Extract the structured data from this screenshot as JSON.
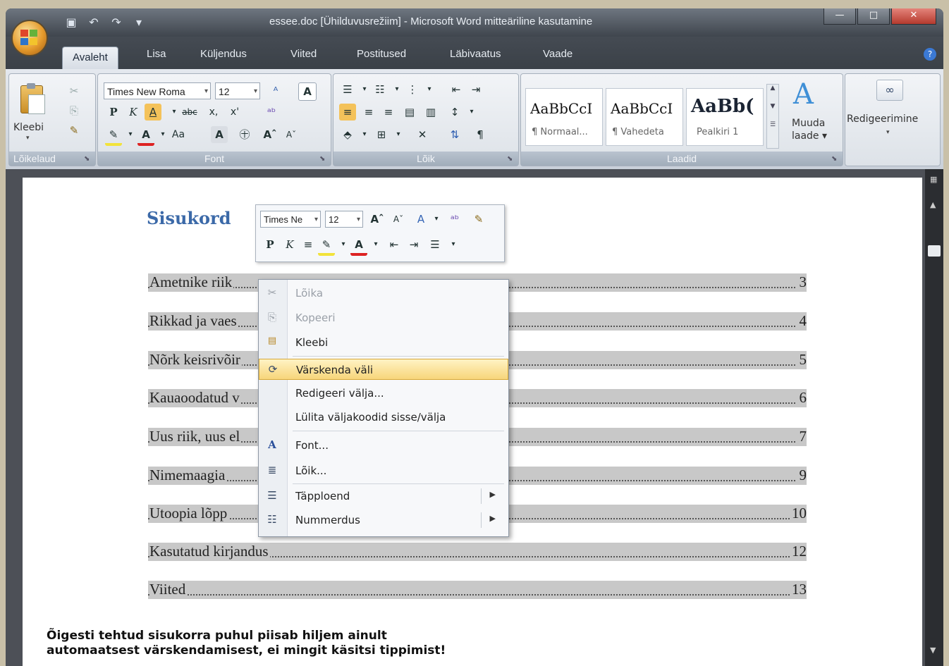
{
  "window": {
    "title": "essee.doc [Ühilduvusrežiim] - Microsoft Word mitteäriline kasutamine"
  },
  "tabs": [
    "Avaleht",
    "Lisa",
    "Küljendus",
    "Viited",
    "Postitused",
    "Läbivaatus",
    "Vaade"
  ],
  "ribbon": {
    "clipboard": {
      "paste_label": "Kleebi",
      "group": "Lõikelaud"
    },
    "font": {
      "family": "Times New Roma",
      "size": "12",
      "group": "Font",
      "case_label": "Aa"
    },
    "paragraph": {
      "group": "Lõik"
    },
    "styles": {
      "group": "Laadid",
      "items": [
        {
          "sample": "AaBbCcI",
          "name": "¶ Normaal..."
        },
        {
          "sample": "AaBbCcI",
          "name": "¶ Vahedeta"
        },
        {
          "sample": "AaBb(",
          "name": "Pealkiri 1"
        }
      ],
      "change_label_1": "Muuda",
      "change_label_2": "laade"
    },
    "editing": {
      "label": "Redigeerimine"
    }
  },
  "mini_toolbar": {
    "font": "Times Ne",
    "size": "12"
  },
  "document": {
    "heading": "Sisukord",
    "toc": [
      {
        "title": "Ametnike riik",
        "page": "3"
      },
      {
        "title": "Rikkad ja vaes",
        "page": "4"
      },
      {
        "title": "Nõrk keisrivõir",
        "page": "5"
      },
      {
        "title": "Kauaoodatud v",
        "page": "6"
      },
      {
        "title": "Uus riik, uus el",
        "page": "7"
      },
      {
        "title": "Nimemaagia",
        "page": "9"
      },
      {
        "title": "Utoopia lõpp",
        "page": "10"
      },
      {
        "title": "Kasutatud kirjandus",
        "page": "12"
      },
      {
        "title": "Viited",
        "page": "13"
      }
    ]
  },
  "context_menu": {
    "items": [
      {
        "label": "Lõika",
        "icon": "scissors-icon",
        "glyph": "✂"
      },
      {
        "label": "Kopeeri",
        "icon": "copy-icon",
        "glyph": "⎘"
      },
      {
        "label": "Kleebi",
        "icon": "paste-icon",
        "glyph": "📋"
      },
      {
        "label": "Värskenda väli",
        "icon": "update-field-icon",
        "glyph": "⟳"
      },
      {
        "label": "Redigeeri välja...",
        "icon": "",
        "glyph": ""
      },
      {
        "label": "Lülita väljakoodid sisse/välja",
        "icon": "",
        "glyph": ""
      },
      {
        "label": "Font...",
        "icon": "font-icon",
        "glyph": "A"
      },
      {
        "label": "Lõik...",
        "icon": "paragraph-icon",
        "glyph": "≣"
      },
      {
        "label": "Täpploend",
        "icon": "bullets-icon",
        "glyph": "☰"
      },
      {
        "label": "Nummerdus",
        "icon": "numbering-icon",
        "glyph": "☷"
      }
    ]
  },
  "caption": "Õigesti tehtud sisukorra puhul piisab hiljem ainult automaatsest värskendamisest, ei mingit käsitsi tippimist!"
}
